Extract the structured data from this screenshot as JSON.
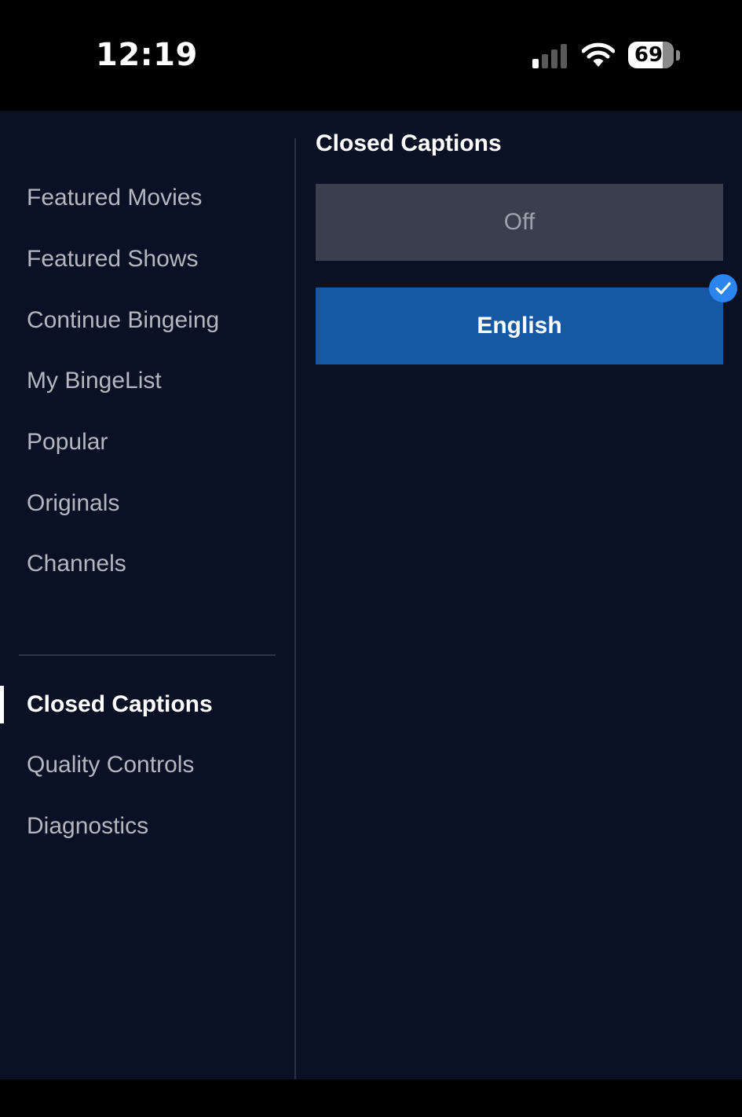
{
  "status_bar": {
    "time": "12:19",
    "battery_level": "69",
    "signal_icon": "cellular-signal-icon",
    "wifi_icon": "wifi-icon"
  },
  "sidebar": {
    "items": [
      {
        "label": "Featured Movies"
      },
      {
        "label": "Featured Shows"
      },
      {
        "label": "Continue Bingeing"
      },
      {
        "label": "My BingeList"
      },
      {
        "label": "Popular"
      },
      {
        "label": "Originals"
      },
      {
        "label": "Channels"
      }
    ],
    "settings_items": [
      {
        "label": "Closed Captions",
        "active": true
      },
      {
        "label": "Quality Controls",
        "active": false
      },
      {
        "label": "Diagnostics",
        "active": false
      }
    ]
  },
  "content": {
    "title": "Closed Captions",
    "options": [
      {
        "label": "Off",
        "selected": false
      },
      {
        "label": "English",
        "selected": true
      }
    ],
    "selected_icon": "checkmark-icon"
  },
  "colors": {
    "background": "#0a1124",
    "selected_option": "#1558a4",
    "unselected_option": "#3a3f4e",
    "check_badge": "#2b85ef"
  }
}
